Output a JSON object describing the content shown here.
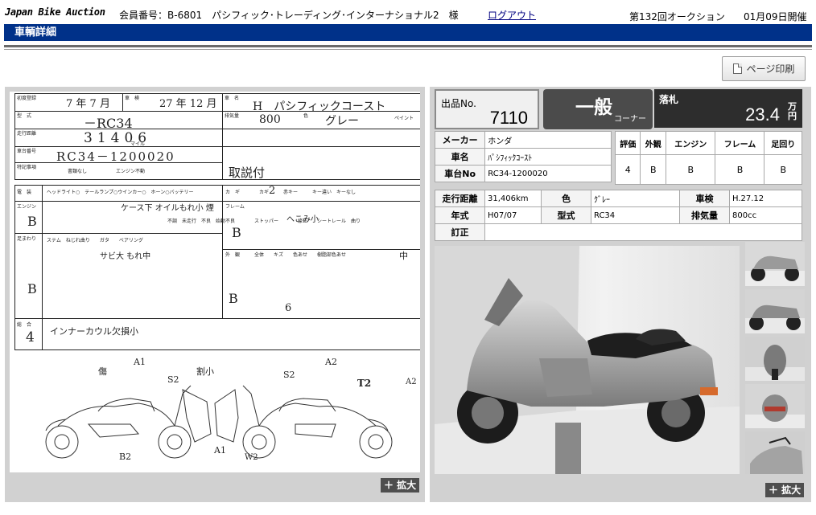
{
  "header": {
    "brand": "Japan Bike Auction",
    "member_info": "会員番号：B-6801　パシフィック･トレーディング･インターナショナル2　様",
    "logout_label": "ログアウト",
    "session": "第132回オークション",
    "date": "01月09日開催"
  },
  "page": {
    "title": "車輌詳細",
    "print_label": "ページ印刷"
  },
  "sheet": {
    "zoom_label": "＋ 拡大",
    "labels": {
      "first_reg": "初度登録",
      "inspection": "車　検",
      "vehicle_name": "車　名",
      "model": "型　式",
      "displacement": "排気量",
      "color": "色",
      "paint": "ペイント",
      "mileage": "走行距離",
      "mile": "マイル",
      "frame_no": "車台番号",
      "special": "特記事項",
      "no_docs": "書類なし",
      "engine_dead": "エンジン不動",
      "electric": "電　装",
      "keys": "カ　ギ",
      "engine": "エンジン",
      "frame": "フレーム",
      "suspension": "足まわり",
      "exterior": "外　観",
      "overall": "総　合",
      "electric_items": "ヘッドライト○　テールランプ○ウインカー○　ホーン○バッテリー",
      "key_items": "カギ　　　赤キー　　　キー違い　キーなし",
      "engine_items": "不調　未走行　不良　始動不良",
      "frame_items": "ストッパー　　　　修正　　シートレール　曲り",
      "front_items": "ステム　ねじれ曲り　　ガタ　　ベアリング",
      "exterior_items": "全体　　キズ　　色あせ　　樹脂部色あせ"
    },
    "hand": {
      "first_reg": "7 年 7 月",
      "inspection": "27 年 12 月",
      "vehicle_name": "H　パシフィックコースト",
      "model": "－RC34",
      "displacement": "800",
      "color": "グレー",
      "mileage": "31406",
      "frame_no": "RC34－1200020",
      "special": "取説付",
      "keys": "2",
      "engine_note": "ケース下 オイルもれ小 煙",
      "engine_grade": "B",
      "frame_grade": "B",
      "frame_note": "へこみ小",
      "front_note": "サビ大 もれ中",
      "susp_grade": "B",
      "exterior_grade": "B",
      "exterior_note": "中",
      "tire": "6",
      "overall": "4",
      "overall_note": "インナーカウル欠損小",
      "marks": [
        "A1",
        "A2",
        "S2",
        "S2",
        "T2",
        "A2",
        "B2",
        "A1",
        "W2",
        "傷",
        "割小"
      ]
    }
  },
  "lot": {
    "label": "出品No.",
    "value": "7110"
  },
  "corner": {
    "main": "一般",
    "sub": "コーナー"
  },
  "bid": {
    "label": "落札",
    "value": "23.4",
    "unit": "万円"
  },
  "info": {
    "maker_label": "メーカー",
    "maker": "ホンダ",
    "name_label": "車名",
    "name": "ﾊﾟｼﾌｨｯｸｺｰｽﾄ",
    "frame_label": "車台No",
    "frame": "RC34-1200020"
  },
  "grades": {
    "headers": [
      "評価",
      "外観",
      "エンジン",
      "フレーム",
      "足回り"
    ],
    "values": [
      "4",
      "B",
      "B",
      "B",
      "B"
    ]
  },
  "spec": {
    "mileage_label": "走行距離",
    "mileage": "31,406km",
    "color_label": "色",
    "color": "ｸﾞﾚｰ",
    "inspection_label": "車検",
    "inspection": "H.27.12",
    "year_label": "年式",
    "year": "H07/07",
    "model_label": "型式",
    "model": "RC34",
    "displacement_label": "排気量",
    "displacement": "800cc",
    "correction_label": "訂正",
    "correction": ""
  },
  "photos": {
    "zoom_label": "＋ 拡大",
    "thumb_count": 5
  }
}
